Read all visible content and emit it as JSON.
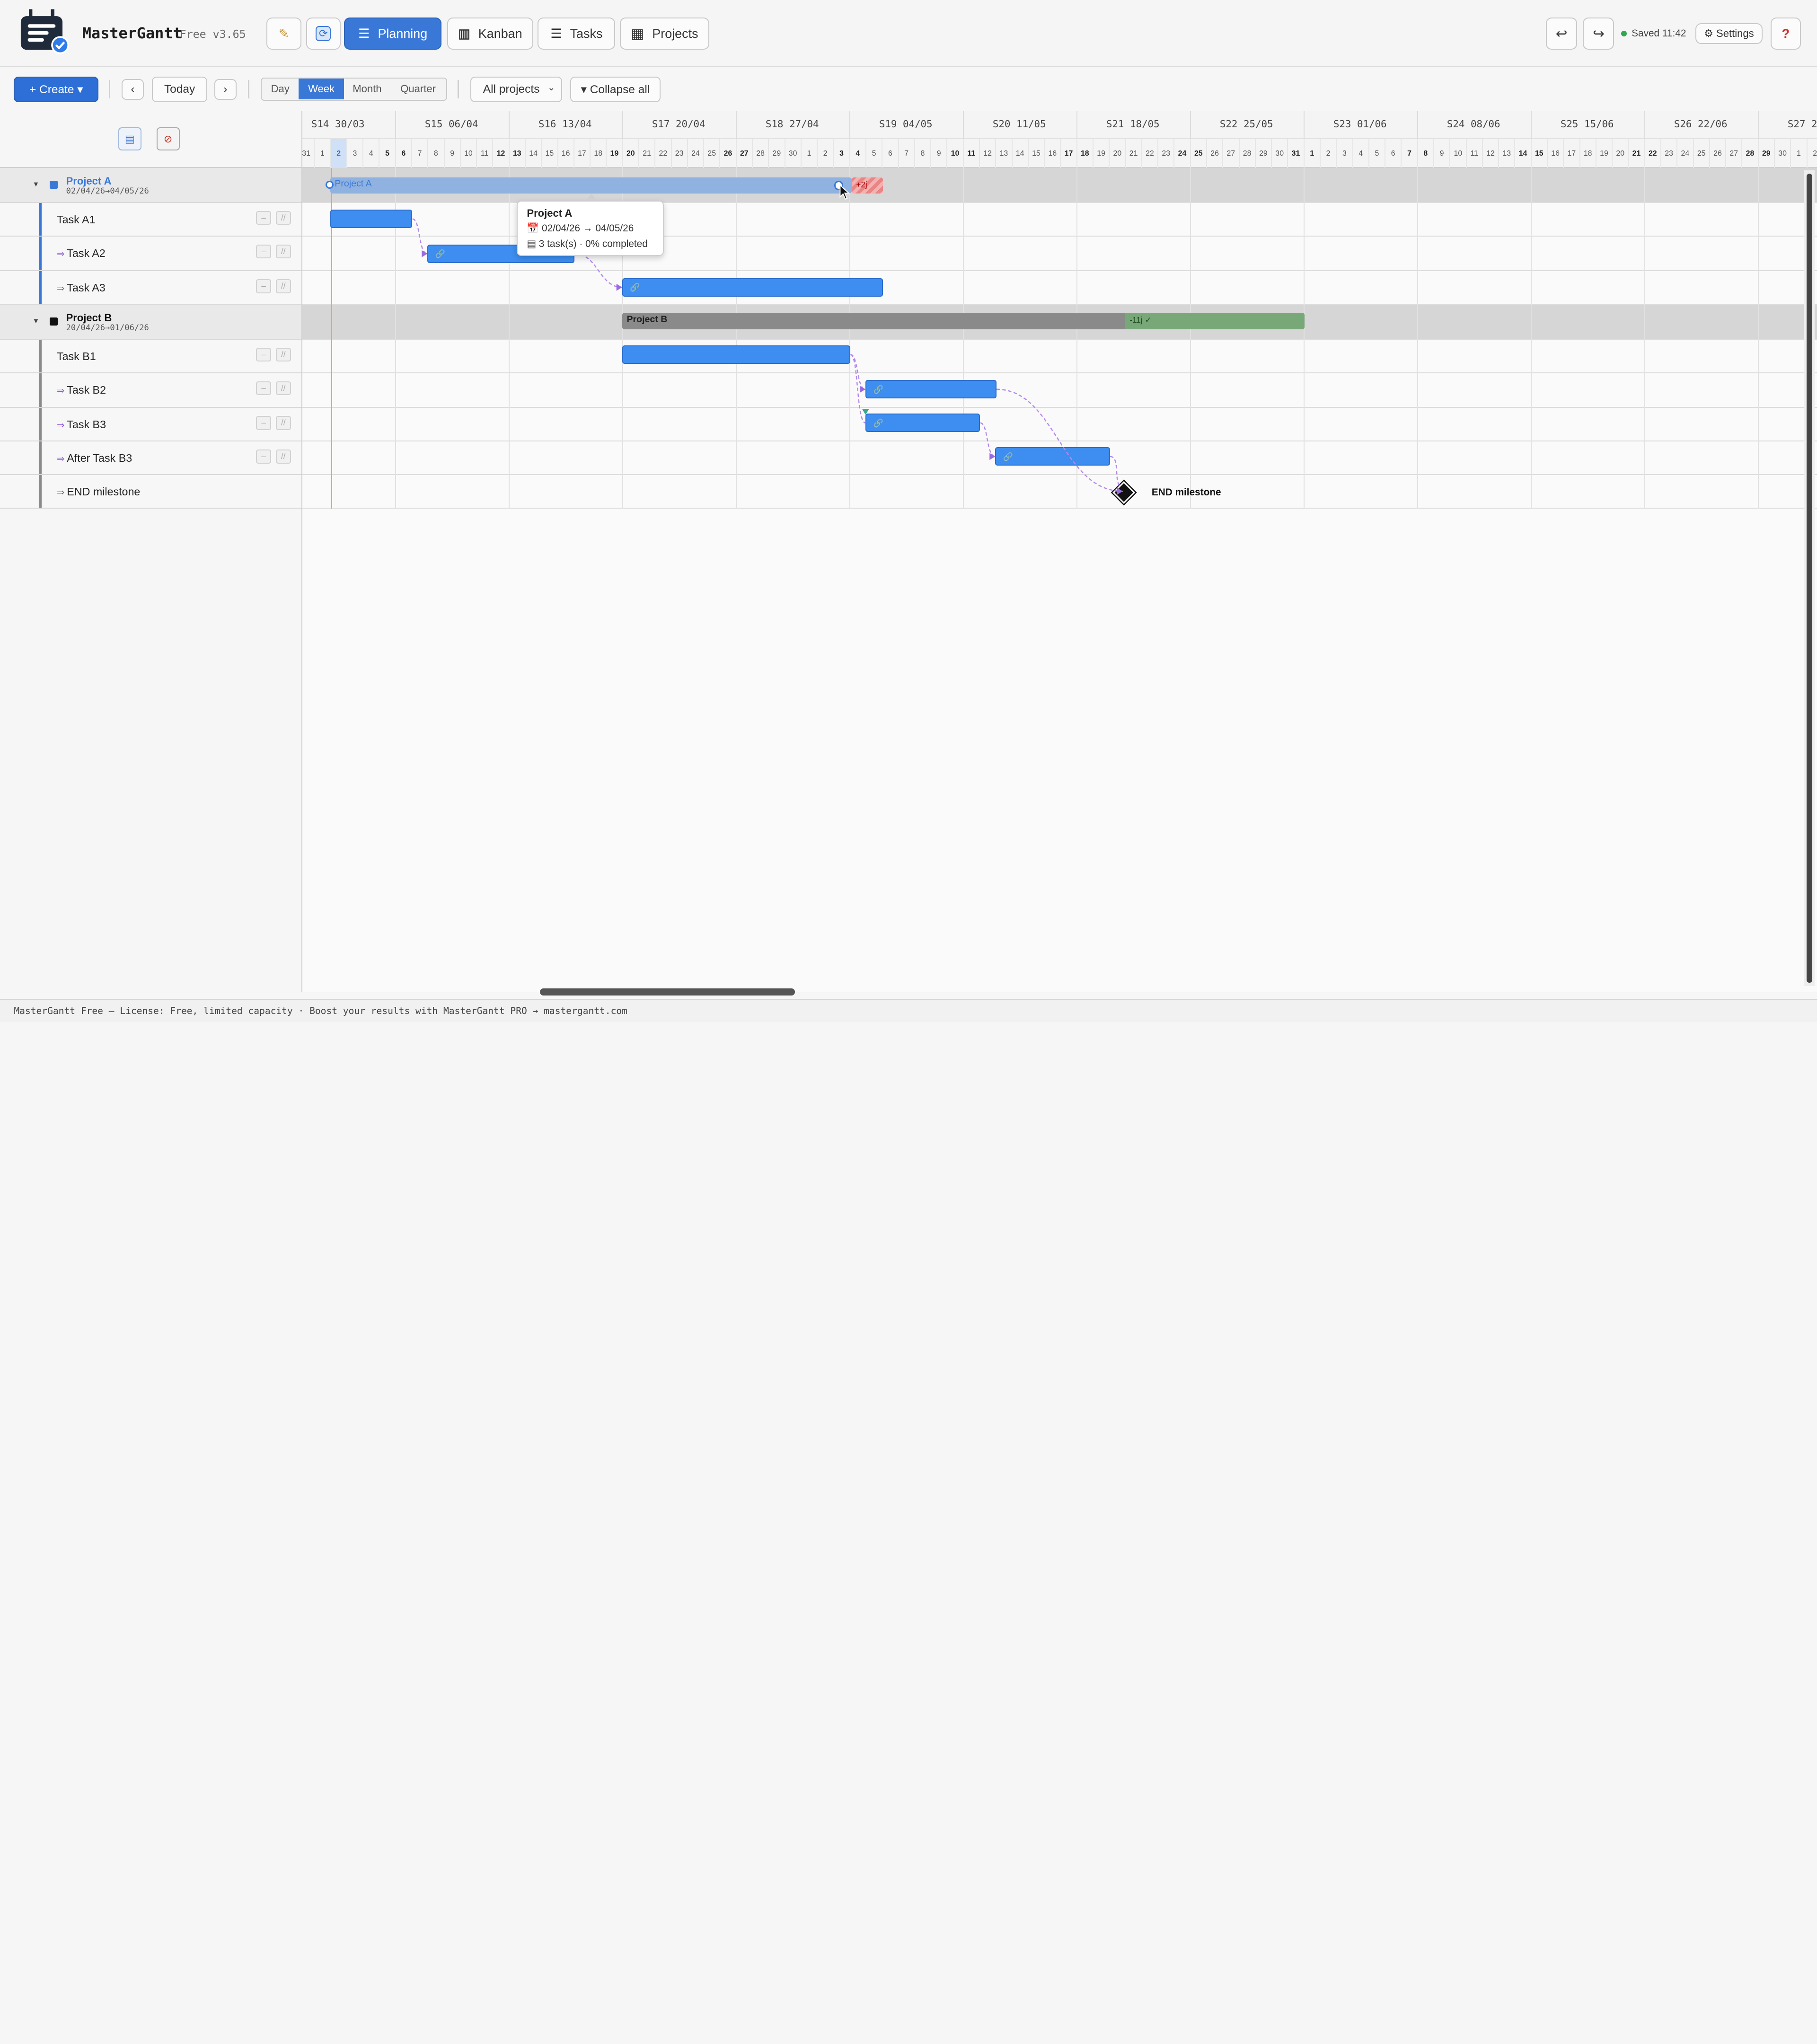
{
  "app": {
    "name": "MasterGantt",
    "version": "Free v3.65"
  },
  "header": {
    "edit_icon": "pencil-icon",
    "sync_icon": "refresh-icon",
    "nav": [
      {
        "label": "Planning",
        "icon": "planning-icon",
        "active": true
      },
      {
        "label": "Kanban",
        "icon": "kanban-icon",
        "active": false
      },
      {
        "label": "Tasks",
        "icon": "list-icon",
        "active": false
      },
      {
        "label": "Projects",
        "icon": "grid-icon",
        "active": false
      }
    ],
    "undo_icon": "undo-icon",
    "redo_icon": "redo-icon",
    "saved": "Saved 11:42",
    "settings": "⚙ Settings",
    "help": "?"
  },
  "toolbar": {
    "create": "+ Create ▾",
    "prev": "‹",
    "today": "Today",
    "next": "›",
    "scales": [
      "Day",
      "Week",
      "Month",
      "Quarter"
    ],
    "active_scale": "Week",
    "project_filter": "All projects",
    "collapse": "▾ Collapse all"
  },
  "timeline": {
    "weeks": [
      "S14 30/03",
      "S15 06/04",
      "S16 13/04",
      "S17 20/04",
      "S18 27/04",
      "S19 04/05",
      "S20 11/05",
      "S21 18/05",
      "S22 25/05",
      "S23 01/06",
      "S24 08/06",
      "S25 15/06",
      "S26 22/06",
      "S27 2"
    ],
    "days": [
      "31",
      "1",
      "2",
      "3",
      "4",
      "5",
      "6",
      "7",
      "8",
      "9",
      "10",
      "11",
      "12",
      "13",
      "14",
      "15",
      "16",
      "17",
      "18",
      "19",
      "20",
      "21",
      "22",
      "23",
      "24",
      "25",
      "26",
      "27",
      "28",
      "29",
      "30",
      "1",
      "2",
      "3",
      "4",
      "5",
      "6",
      "7",
      "8",
      "9",
      "10",
      "11",
      "12",
      "13",
      "14",
      "15",
      "16",
      "17",
      "18",
      "19",
      "20",
      "21",
      "22",
      "23",
      "24",
      "25",
      "26",
      "27",
      "28",
      "29",
      "30",
      "31",
      "1",
      "2",
      "3",
      "4",
      "5",
      "6",
      "7",
      "8",
      "9",
      "10",
      "11",
      "12",
      "13",
      "14",
      "15",
      "16",
      "17",
      "18",
      "19",
      "20",
      "21",
      "22",
      "23",
      "24",
      "25",
      "26",
      "27",
      "28",
      "29",
      "30",
      "1",
      "2"
    ],
    "today_day": "2"
  },
  "rows": [
    {
      "type": "project",
      "name": "Project A",
      "dates": "02/04/26→04/05/26",
      "color": "#3a78d8"
    },
    {
      "type": "task",
      "name": "Task A1",
      "dep": false
    },
    {
      "type": "task",
      "name": "Task A2",
      "dep": true
    },
    {
      "type": "task",
      "name": "Task A3",
      "dep": true
    },
    {
      "type": "project",
      "name": "Project B",
      "dates": "20/04/26→01/06/26",
      "color": "#111111"
    },
    {
      "type": "task",
      "name": "Task B1",
      "dep": false
    },
    {
      "type": "task",
      "name": "Task B2",
      "dep": true
    },
    {
      "type": "task",
      "name": "Task B3",
      "dep": true
    },
    {
      "type": "task",
      "name": "After Task B3",
      "dep": true
    },
    {
      "type": "task",
      "name": "END milestone",
      "dep": true
    }
  ],
  "bars": {
    "project_a_label": "Project A",
    "project_a_late": "+2j",
    "project_b_label": "Project B",
    "project_b_early": "-11j ✓",
    "milestone_label": "END milestone"
  },
  "tooltip": {
    "title": "Project A",
    "dates": "📅 02/04/26 → 04/05/26",
    "summary": "▤ 3 task(s) · 0% completed"
  },
  "footer": "MasterGantt Free — License: Free, limited capacity · Boost your results with MasterGantt PRO → mastergantt.com",
  "colors": {
    "accent": "#3a78d8",
    "bar": "#3d8ef0",
    "late": "#e88585",
    "early": "#78a878",
    "dependency": "#b388ee"
  }
}
